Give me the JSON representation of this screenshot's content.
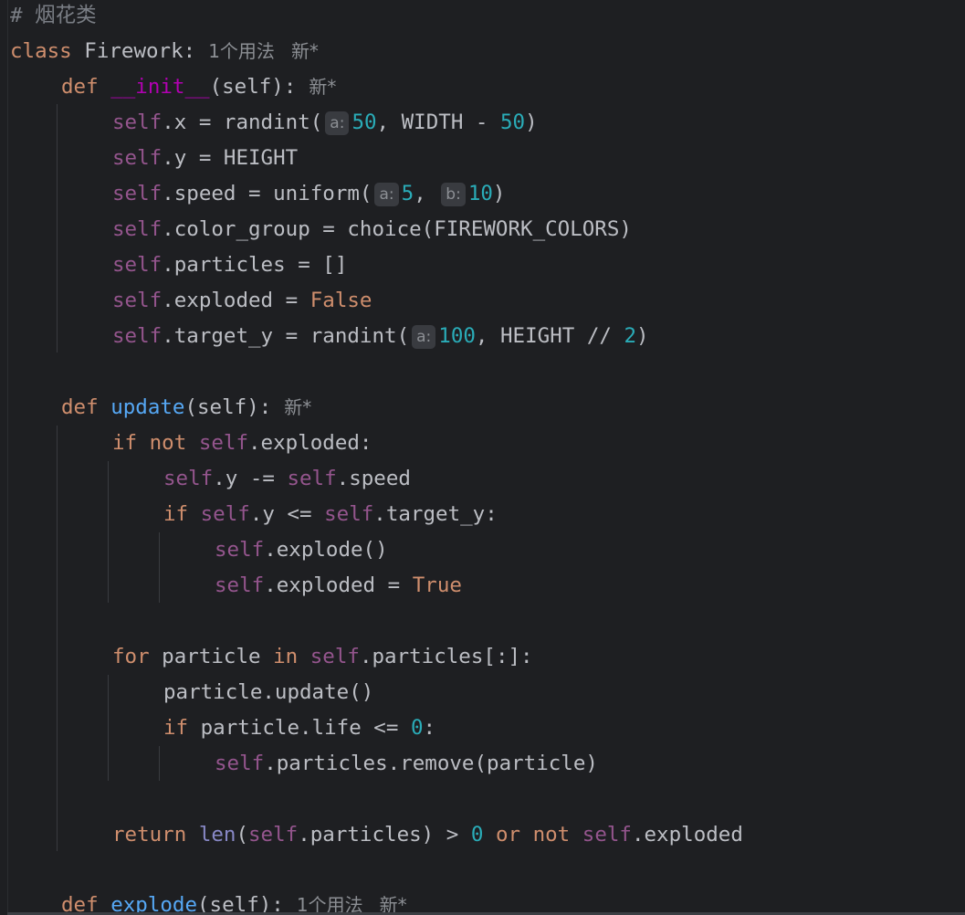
{
  "comment_line": "# 烟花类",
  "class_line": {
    "kw": "class",
    "name": "Firework:",
    "usage": "1个用法",
    "status": "新*"
  },
  "methods": {
    "init": {
      "kw": "def",
      "name": "__init__",
      "params": "(self):",
      "status": "新*"
    },
    "update": {
      "kw": "def",
      "name": "update",
      "params": "(self):",
      "status": "新*"
    },
    "explode": {
      "kw": "def",
      "name": "explode",
      "params": "(self):",
      "usage": "1个用法",
      "status": "新*"
    }
  },
  "init_body": {
    "x_target": ".x = randint(",
    "x_hint": "a:",
    "x_a": "50",
    "x_mid": ", WIDTH - ",
    "x_b": "50",
    "x_end": ")",
    "y_line": ".y = HEIGHT",
    "speed_target": ".speed = uniform(",
    "speed_hint_a": "a:",
    "speed_a": "5",
    "speed_comma": ",",
    "speed_hint_b": "b:",
    "speed_b": "10",
    "speed_end": ")",
    "color_line": ".color_group = choice(FIREWORK_COLORS)",
    "particles_line": ".particles = []",
    "exploded_target": ".exploded = ",
    "exploded_val": "False",
    "ty_target": ".target_y = randint(",
    "ty_hint": "a:",
    "ty_a": "100",
    "ty_mid": ", HEIGHT // ",
    "ty_b": "2",
    "ty_end": ")"
  },
  "update_body": {
    "if_kw": "if",
    "not_kw": "not",
    "if_rest": ".exploded:",
    "y_minus": ".y -= ",
    "speed_attr": ".speed",
    "if2_rest1": ".y <= ",
    "if2_rest2": ".target_y:",
    "explode_call": ".explode()",
    "exploded_true": ".exploded = ",
    "true_val": "True",
    "for_kw": "for",
    "for_var": " particle ",
    "in_kw": "in",
    "for_rest": ".particles[:]:",
    "p_update": "particle.update()",
    "if3_rest": " particle.life <= ",
    "zero": "0",
    "colon": ":",
    "remove_call": ".particles.remove(particle)",
    "return_kw": "return",
    "len_fn": "len",
    "ret_mid": "(",
    "ret_mid2": ".particles) > ",
    "ret_zero": "0",
    "or_kw": "or",
    "ret_not": "not",
    "ret_tail": ".exploded"
  },
  "self_word": "self",
  "colors": {
    "background": "#1e1f22",
    "keyword": "#cf8e6d",
    "self": "#94558d",
    "number": "#2aacb8",
    "function": "#56a8f5",
    "magic": "#b200b2",
    "builtin": "#8888c6",
    "text": "#bcbec4"
  }
}
